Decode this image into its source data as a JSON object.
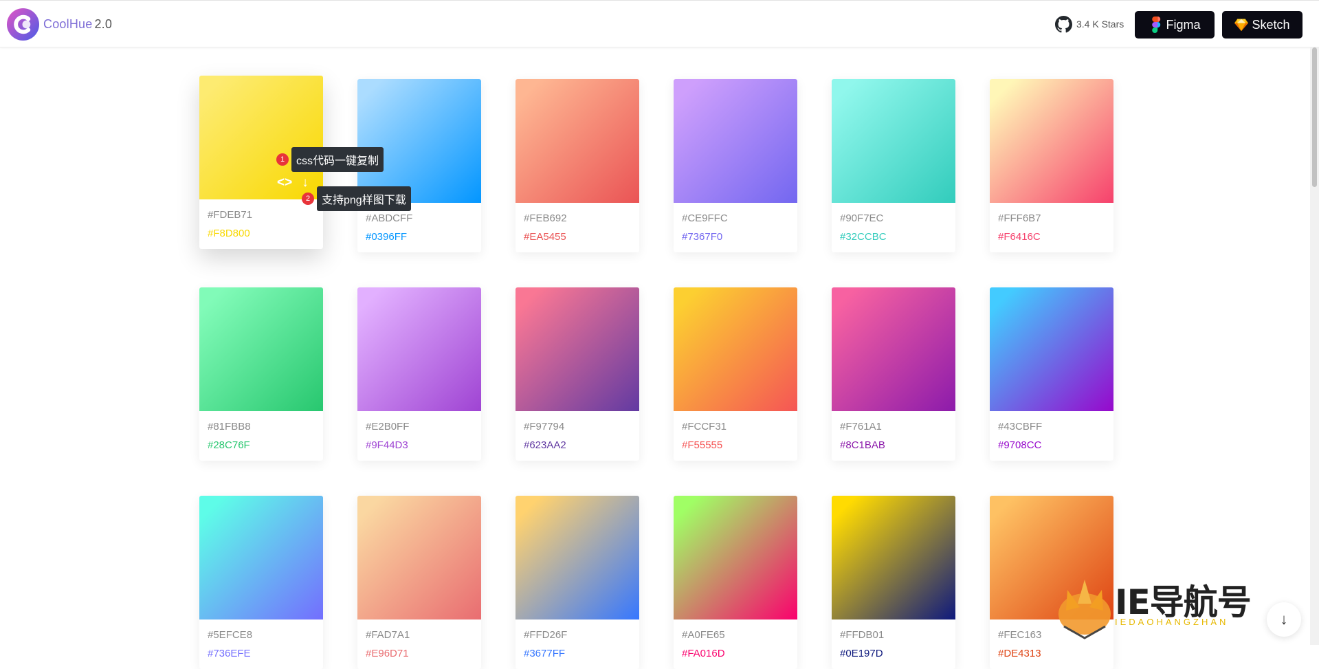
{
  "header": {
    "brand_name": "CoolHue",
    "brand_version": "2.0",
    "stars": "3.4 K Stars",
    "figma_label": "Figma",
    "sketch_label": "Sketch",
    "brand_color": "#7d6cd6"
  },
  "cards": [
    {
      "c1": "#FDEB71",
      "c2": "#F8D800"
    },
    {
      "c1": "#ABDCFF",
      "c2": "#0396FF"
    },
    {
      "c1": "#FEB692",
      "c2": "#EA5455"
    },
    {
      "c1": "#CE9FFC",
      "c2": "#7367F0"
    },
    {
      "c1": "#90F7EC",
      "c2": "#32CCBC"
    },
    {
      "c1": "#FFF6B7",
      "c2": "#F6416C"
    },
    {
      "c1": "#81FBB8",
      "c2": "#28C76F"
    },
    {
      "c1": "#E2B0FF",
      "c2": "#9F44D3"
    },
    {
      "c1": "#F97794",
      "c2": "#623AA2"
    },
    {
      "c1": "#FCCF31",
      "c2": "#F55555"
    },
    {
      "c1": "#F761A1",
      "c2": "#8C1BAB"
    },
    {
      "c1": "#43CBFF",
      "c2": "#9708CC"
    },
    {
      "c1": "#5EFCE8",
      "c2": "#736EFE"
    },
    {
      "c1": "#FAD7A1",
      "c2": "#E96D71"
    },
    {
      "c1": "#FFD26F",
      "c2": "#3677FF"
    },
    {
      "c1": "#A0FE65",
      "c2": "#FA016D"
    },
    {
      "c1": "#FFDB01",
      "c2": "#0E197D"
    },
    {
      "c1": "#FEC163",
      "c2": "#DE4313"
    }
  ],
  "hover": {
    "code_icon": "code-icon",
    "download_icon": "download-icon",
    "callout1_num": "1",
    "callout1_text": "css代码一键复制",
    "callout2_num": "2",
    "callout2_text": "支持png样图下载"
  },
  "watermark": {
    "text": "IE导航号",
    "sub": "IEDAOHANGZHAN"
  }
}
